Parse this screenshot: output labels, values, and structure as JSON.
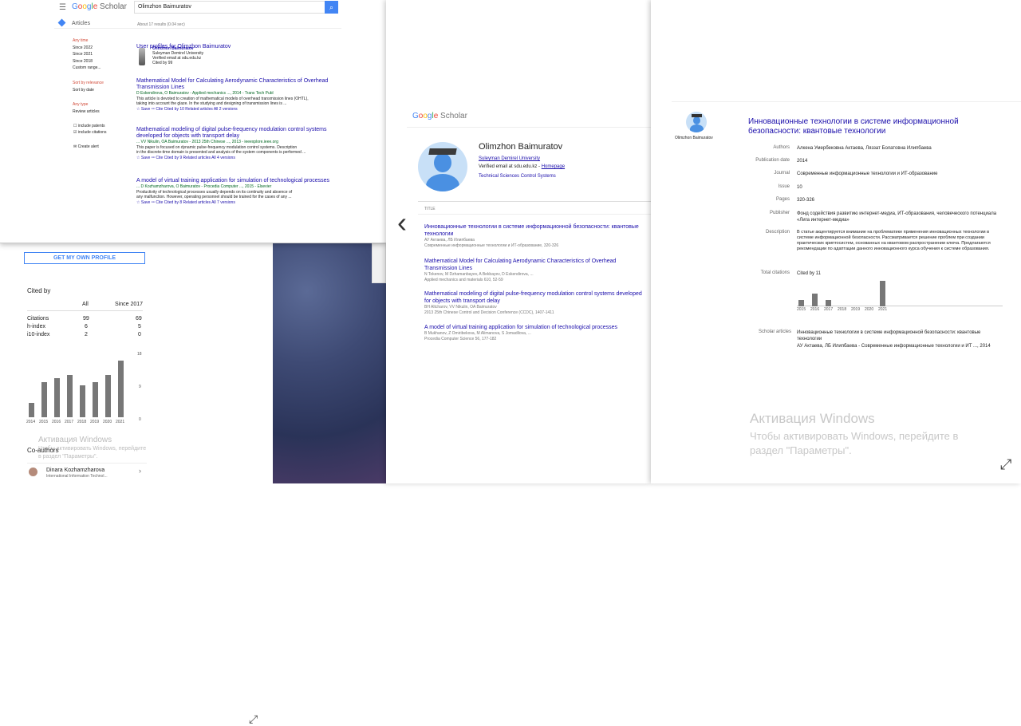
{
  "left_results": {
    "logo": "Google Scholar",
    "search_query": "Olimzhon Baimuratov",
    "articles_label": "Articles",
    "about": "About 17 results (0.04 sec)",
    "sidebar": {
      "any_time": "Any time",
      "since2022": "Since 2022",
      "since2021": "Since 2021",
      "since2018": "Since 2018",
      "custom": "Custom range...",
      "sort_rel": "Sort by relevance",
      "sort_date": "Sort by date",
      "any_type": "Any type",
      "review": "Review articles",
      "patents": "include patents",
      "citations": "include citations",
      "alert": "Create alert"
    },
    "profiles_head": "User profiles for Olimzhon Baimuratov",
    "profile": {
      "name": "Olimzhon Baimuratov",
      "org": "Suleyman Demirel University",
      "email": "Verified email at sdu.edu.kz",
      "cited": "Cited by 99"
    },
    "results": [
      {
        "title": "Mathematical Model for Calculating Aerodynamic Characteristics of Overhead Transmission Lines",
        "meta": "D Eskendirova, O Baimuratov - Applied mechanics ..., 2014 - Trans Tech Publ",
        "snippet1": "This article is devoted to creation of mathematical models of overhead transmission lines (OHTL),",
        "snippet2": "taking into account the glaze. In the studying and designing of transmission lines is ...",
        "actions": "☆ Save   ⁹⁹ Cite   Cited by 10   Related articles   All 2 versions"
      },
      {
        "title": "Mathematical modeling of digital pulse-frequency modulation control systems developed for objects with transport delay",
        "meta": "... VV Nikulin, OA Baimuratov - 2013 25th Chinese ..., 2013 - ieeexplore.ieee.org",
        "snippet1": "This paper is focused on dynamic pulse-frequency modulation control systems. Description",
        "snippet2": "in the discrete-time domain is presented and analysis of the system components is performed ...",
        "actions": "☆ Save   ⁹⁹ Cite   Cited by 9   Related articles   All 4 versions"
      },
      {
        "title": "A model of virtual training application for simulation of technological processes",
        "meta": "... D Kozhamzharova, O Baimuratov - Procedia Computer ..., 2015 - Elsevier",
        "snippet1": "Productivity of technological processes usually depends on its continuity and absence of",
        "snippet2": "any malfunction. However, operating personnel should be trained for the cases of any ...",
        "actions": "☆ Save   ⁹⁹ Cite   Cited by 8   Related articles   All 7 versions"
      }
    ]
  },
  "left_profile": {
    "get_profile": "GET MY OWN PROFILE",
    "cited_by": "Cited by",
    "col_all": "All",
    "col_since": "Since 2017",
    "rows": [
      {
        "label": "Citations",
        "all": "99",
        "since": "69"
      },
      {
        "label": "h-index",
        "all": "6",
        "since": "5"
      },
      {
        "label": "i10-index",
        "all": "2",
        "since": "0"
      }
    ],
    "chart_ticks": [
      "18",
      "9",
      "0"
    ],
    "years": [
      "2014",
      "2015",
      "2016",
      "2017",
      "2018",
      "2019",
      "2020",
      "2021"
    ],
    "watermark_title": "Активация Windows",
    "watermark_text": "Чтобы активировать Windows, перейдите в раздел \"Параметры\".",
    "coauthors": "Co-authors",
    "coauthor1": "Dinara Kozhamzharova",
    "coauthor1_sub": "International Information Technol..."
  },
  "chart_data": [
    {
      "type": "bar",
      "categories": [
        "2014",
        "2015",
        "2016",
        "2017",
        "2018",
        "2019",
        "2020",
        "2021"
      ],
      "values": [
        4,
        10,
        11,
        12,
        9,
        10,
        12,
        16
      ],
      "ylim": [
        0,
        18
      ]
    },
    {
      "type": "bar",
      "categories": [
        "2015",
        "2016",
        "2017",
        "2018",
        "2019",
        "2020",
        "2021"
      ],
      "values": [
        1,
        2,
        1,
        0,
        0,
        0,
        4
      ]
    }
  ],
  "middle_profile": {
    "logo": "Google Scholar",
    "name": "Olimzhon Baimuratov",
    "org": "Suleyman Demirel University",
    "email": "Verified email at sdu.edu.kz",
    "homepage": "Homepage",
    "interests": "Technical Sciences   Control Systems",
    "title_col": "TITLE",
    "articles": [
      {
        "title": "Инновационные технологии в системе информационной безопасности: квантовые технологии",
        "authors": "АУ Актаева, ЛБ Илипбаева",
        "venue": "Современные информационные технологии и ИТ-образование, 320-326"
      },
      {
        "title": "Mathematical Model for Calculating Aerodynamic Characteristics of Overhead Transmission Lines",
        "authors": "N Tokenov, M Dzhamanbayev, A Bekbayev, D Eskendirova, ...",
        "venue": "Applied mechanics and materials 610, 52-59"
      },
      {
        "title": "Mathematical modeling of digital pulse-frequency modulation control systems developed for objects with transport delay",
        "authors": "BH Altcharov, VV Nikulin, OA Baimuratov",
        "venue": "2013 25th Chinese Control and Decision Conference (CCDC), 1407-1411"
      },
      {
        "title": "A model of virtual training application for simulation of technological processes",
        "authors": "B Mukhanov, Z Omiribekova, M Alimanova, S Jomadilova, ...",
        "venue": "Procedia Computer Science 56, 177-182"
      }
    ]
  },
  "right_detail": {
    "name": "Olimzhon Baimuratov",
    "title": "Инновационные технологии в системе информационной безопасности: квантовые технологии",
    "fields": {
      "authors_l": "Authors",
      "authors_v": "Алкена Умербековна Актаева, Ляззат Болатовна Илипбаева",
      "date_l": "Publication date",
      "date_v": "2014",
      "journal_l": "Journal",
      "journal_v": "Современные информационные технологии и ИТ-образование",
      "issue_l": "Issue",
      "issue_v": "10",
      "pages_l": "Pages",
      "pages_v": "320-326",
      "publisher_l": "Publisher",
      "publisher_v": "Фонд содействия развитию интернет-медиа, ИТ-образования, человеческого потенциала «Лига интернет-медиа»",
      "desc_l": "Description",
      "desc_v": "В статье акцентируется внимание на проблематике применения инновационных технологии в системе информационной безопасности. Рассматривается решение проблем при создании практических криптосистем, основанных на квантовом распространении ключа. Предлагаются рекомендации по адаптации данного инновационного курса обучения к системе образования.",
      "total_l": "Total citations",
      "total_v": "Cited by 11",
      "scholar_l": "Scholar articles",
      "scholar_v": "Инновационные технологии в системе информационной безопасности: квантовые технологии",
      "scholar_sub": "АУ Актаева, ЛБ Илипбаева - Современные информационные технологии и ИТ ..., 2014"
    },
    "years": [
      "2015",
      "2016",
      "2017",
      "2018",
      "2019",
      "2020",
      "2021"
    ],
    "watermark_title": "Активация Windows",
    "watermark_text": "Чтобы активировать Windows, перейдите в раздел \"Параметры\"."
  },
  "icons": {
    "menu": "☰",
    "search": "⌕",
    "back": "‹",
    "expand": "⤢"
  }
}
